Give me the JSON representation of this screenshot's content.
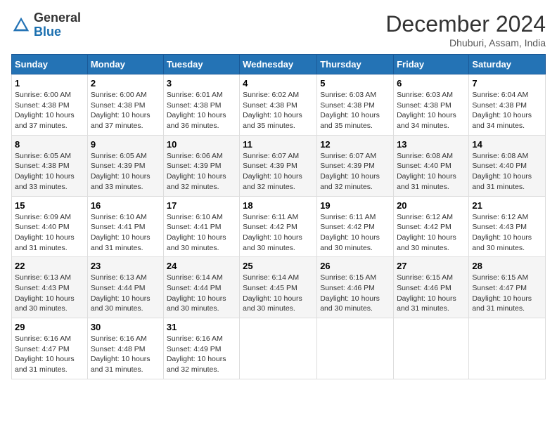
{
  "header": {
    "logo_general": "General",
    "logo_blue": "Blue",
    "month_title": "December 2024",
    "subtitle": "Dhuburi, Assam, India"
  },
  "weekdays": [
    "Sunday",
    "Monday",
    "Tuesday",
    "Wednesday",
    "Thursday",
    "Friday",
    "Saturday"
  ],
  "weeks": [
    [
      {
        "day": "1",
        "sunrise": "6:00 AM",
        "sunset": "4:38 PM",
        "daylight": "10 hours and 37 minutes."
      },
      {
        "day": "2",
        "sunrise": "6:00 AM",
        "sunset": "4:38 PM",
        "daylight": "10 hours and 37 minutes."
      },
      {
        "day": "3",
        "sunrise": "6:01 AM",
        "sunset": "4:38 PM",
        "daylight": "10 hours and 36 minutes."
      },
      {
        "day": "4",
        "sunrise": "6:02 AM",
        "sunset": "4:38 PM",
        "daylight": "10 hours and 35 minutes."
      },
      {
        "day": "5",
        "sunrise": "6:03 AM",
        "sunset": "4:38 PM",
        "daylight": "10 hours and 35 minutes."
      },
      {
        "day": "6",
        "sunrise": "6:03 AM",
        "sunset": "4:38 PM",
        "daylight": "10 hours and 34 minutes."
      },
      {
        "day": "7",
        "sunrise": "6:04 AM",
        "sunset": "4:38 PM",
        "daylight": "10 hours and 34 minutes."
      }
    ],
    [
      {
        "day": "8",
        "sunrise": "6:05 AM",
        "sunset": "4:38 PM",
        "daylight": "10 hours and 33 minutes."
      },
      {
        "day": "9",
        "sunrise": "6:05 AM",
        "sunset": "4:39 PM",
        "daylight": "10 hours and 33 minutes."
      },
      {
        "day": "10",
        "sunrise": "6:06 AM",
        "sunset": "4:39 PM",
        "daylight": "10 hours and 32 minutes."
      },
      {
        "day": "11",
        "sunrise": "6:07 AM",
        "sunset": "4:39 PM",
        "daylight": "10 hours and 32 minutes."
      },
      {
        "day": "12",
        "sunrise": "6:07 AM",
        "sunset": "4:39 PM",
        "daylight": "10 hours and 32 minutes."
      },
      {
        "day": "13",
        "sunrise": "6:08 AM",
        "sunset": "4:40 PM",
        "daylight": "10 hours and 31 minutes."
      },
      {
        "day": "14",
        "sunrise": "6:08 AM",
        "sunset": "4:40 PM",
        "daylight": "10 hours and 31 minutes."
      }
    ],
    [
      {
        "day": "15",
        "sunrise": "6:09 AM",
        "sunset": "4:40 PM",
        "daylight": "10 hours and 31 minutes."
      },
      {
        "day": "16",
        "sunrise": "6:10 AM",
        "sunset": "4:41 PM",
        "daylight": "10 hours and 31 minutes."
      },
      {
        "day": "17",
        "sunrise": "6:10 AM",
        "sunset": "4:41 PM",
        "daylight": "10 hours and 30 minutes."
      },
      {
        "day": "18",
        "sunrise": "6:11 AM",
        "sunset": "4:42 PM",
        "daylight": "10 hours and 30 minutes."
      },
      {
        "day": "19",
        "sunrise": "6:11 AM",
        "sunset": "4:42 PM",
        "daylight": "10 hours and 30 minutes."
      },
      {
        "day": "20",
        "sunrise": "6:12 AM",
        "sunset": "4:42 PM",
        "daylight": "10 hours and 30 minutes."
      },
      {
        "day": "21",
        "sunrise": "6:12 AM",
        "sunset": "4:43 PM",
        "daylight": "10 hours and 30 minutes."
      }
    ],
    [
      {
        "day": "22",
        "sunrise": "6:13 AM",
        "sunset": "4:43 PM",
        "daylight": "10 hours and 30 minutes."
      },
      {
        "day": "23",
        "sunrise": "6:13 AM",
        "sunset": "4:44 PM",
        "daylight": "10 hours and 30 minutes."
      },
      {
        "day": "24",
        "sunrise": "6:14 AM",
        "sunset": "4:44 PM",
        "daylight": "10 hours and 30 minutes."
      },
      {
        "day": "25",
        "sunrise": "6:14 AM",
        "sunset": "4:45 PM",
        "daylight": "10 hours and 30 minutes."
      },
      {
        "day": "26",
        "sunrise": "6:15 AM",
        "sunset": "4:46 PM",
        "daylight": "10 hours and 30 minutes."
      },
      {
        "day": "27",
        "sunrise": "6:15 AM",
        "sunset": "4:46 PM",
        "daylight": "10 hours and 31 minutes."
      },
      {
        "day": "28",
        "sunrise": "6:15 AM",
        "sunset": "4:47 PM",
        "daylight": "10 hours and 31 minutes."
      }
    ],
    [
      {
        "day": "29",
        "sunrise": "6:16 AM",
        "sunset": "4:47 PM",
        "daylight": "10 hours and 31 minutes."
      },
      {
        "day": "30",
        "sunrise": "6:16 AM",
        "sunset": "4:48 PM",
        "daylight": "10 hours and 31 minutes."
      },
      {
        "day": "31",
        "sunrise": "6:16 AM",
        "sunset": "4:49 PM",
        "daylight": "10 hours and 32 minutes."
      },
      null,
      null,
      null,
      null
    ]
  ]
}
